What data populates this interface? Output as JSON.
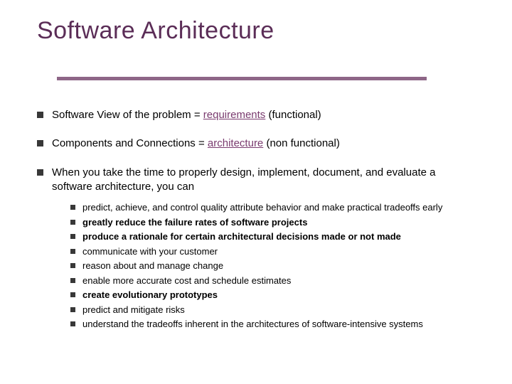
{
  "title": "Software Architecture",
  "bullets": [
    {
      "prefix": "Software View of the problem = ",
      "highlight": "requirements",
      "suffix": " (functional)"
    },
    {
      "prefix": "Components and Connections = ",
      "highlight": "architecture",
      "suffix": " (non functional)"
    },
    {
      "prefix": "When you take the time to properly design, implement, document, and evaluate a software architecture, you can",
      "highlight": "",
      "suffix": ""
    }
  ],
  "subbullets": [
    {
      "text": "predict, achieve, and control quality attribute behavior and make practical tradeoffs early",
      "bold": false
    },
    {
      "text": "greatly reduce the failure rates of software projects",
      "bold": true
    },
    {
      "text": "produce a rationale for certain architectural decisions made or not made",
      "bold": true
    },
    {
      "text": "communicate with your customer",
      "bold": false
    },
    {
      "text": "reason about and manage change",
      "bold": false
    },
    {
      "text": "enable more accurate cost and schedule estimates",
      "bold": false
    },
    {
      "text": "create evolutionary prototypes",
      "bold": true
    },
    {
      "text": "predict and mitigate risks",
      "bold": false
    },
    {
      "text": "understand the tradeoffs inherent in the architectures of software-intensive systems",
      "bold": false
    }
  ]
}
